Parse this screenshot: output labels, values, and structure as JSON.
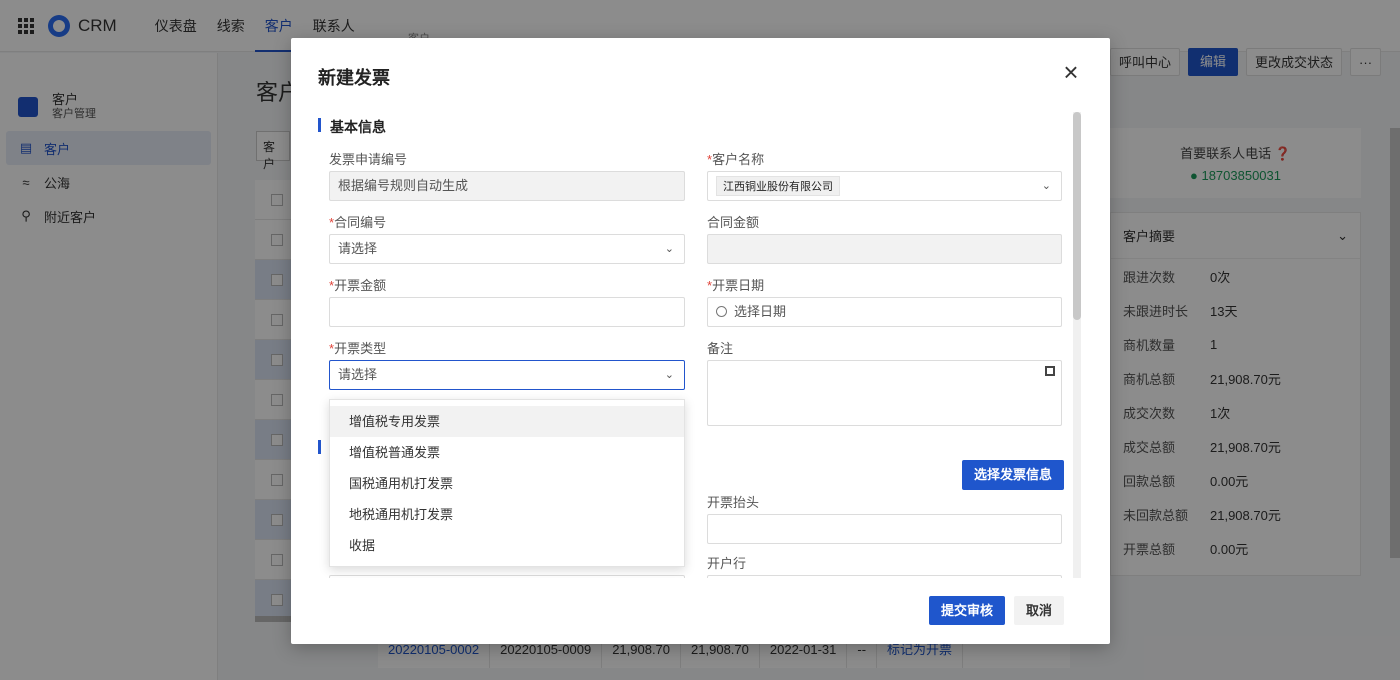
{
  "app": {
    "name": "CRM",
    "nav": [
      "仪表盘",
      "线索",
      "客户",
      "联系人"
    ],
    "active_nav": "客户"
  },
  "sidebar": {
    "header_title": "客户",
    "header_subtitle": "客户管理",
    "items": [
      {
        "label": "客户",
        "icon": "building-icon"
      },
      {
        "label": "公海",
        "icon": "waves-icon"
      },
      {
        "label": "附近客户",
        "icon": "location-pin-icon"
      }
    ]
  },
  "main": {
    "title": "客户",
    "filter_placeholder": "客户",
    "breadcrumb": "客户"
  },
  "actions": {
    "call_center": "呼叫中心",
    "edit": "编辑",
    "change_status": "更改成交状态",
    "more": "···"
  },
  "contact": {
    "label": "首要联系人电话",
    "phone": "18703850031"
  },
  "summary": {
    "title": "客户摘要",
    "rows": [
      {
        "k": "跟进次数",
        "v": "0次"
      },
      {
        "k": "未跟进时长",
        "v": "13天"
      },
      {
        "k": "商机数量",
        "v": "1"
      },
      {
        "k": "商机总额",
        "v": "21,908.70元"
      },
      {
        "k": "成交次数",
        "v": "1次"
      },
      {
        "k": "成交总额",
        "v": "21,908.70元"
      },
      {
        "k": "回款总额",
        "v": "0.00元"
      },
      {
        "k": "未回款总额",
        "v": "21,908.70元"
      },
      {
        "k": "开票总额",
        "v": "0.00元"
      }
    ]
  },
  "bottom_table_row": {
    "cells": [
      "20220105-0002",
      "20220105-0009",
      "21,908.70",
      "21,908.70",
      "2022-01-31",
      "--"
    ],
    "action": "标记为开票"
  },
  "modal": {
    "title": "新建发票",
    "section_basic": "基本信息",
    "fields": {
      "apply_no": {
        "label": "发票申请编号",
        "placeholder": "根据编号规则自动生成"
      },
      "customer": {
        "label": "客户名称",
        "value": "江西铜业股份有限公司"
      },
      "contract_no": {
        "label": "合同编号",
        "placeholder": "请选择"
      },
      "contract_amount": {
        "label": "合同金额",
        "value": ""
      },
      "invoice_amount": {
        "label": "开票金额",
        "value": ""
      },
      "invoice_date": {
        "label": "开票日期",
        "placeholder": "选择日期"
      },
      "invoice_type": {
        "label": "开票类型",
        "placeholder": "请选择"
      },
      "remark": {
        "label": "备注",
        "value": ""
      },
      "invoice_title": {
        "label": "开票抬头",
        "value": ""
      },
      "bank": {
        "label": "开户行",
        "value": ""
      }
    },
    "dropdown_options": [
      "增值税专用发票",
      "增值税普通发票",
      "国税通用机打发票",
      "地税通用机打发票",
      "收据"
    ],
    "select_invoice_info": "选择发票信息",
    "submit": "提交审核",
    "cancel": "取消"
  }
}
